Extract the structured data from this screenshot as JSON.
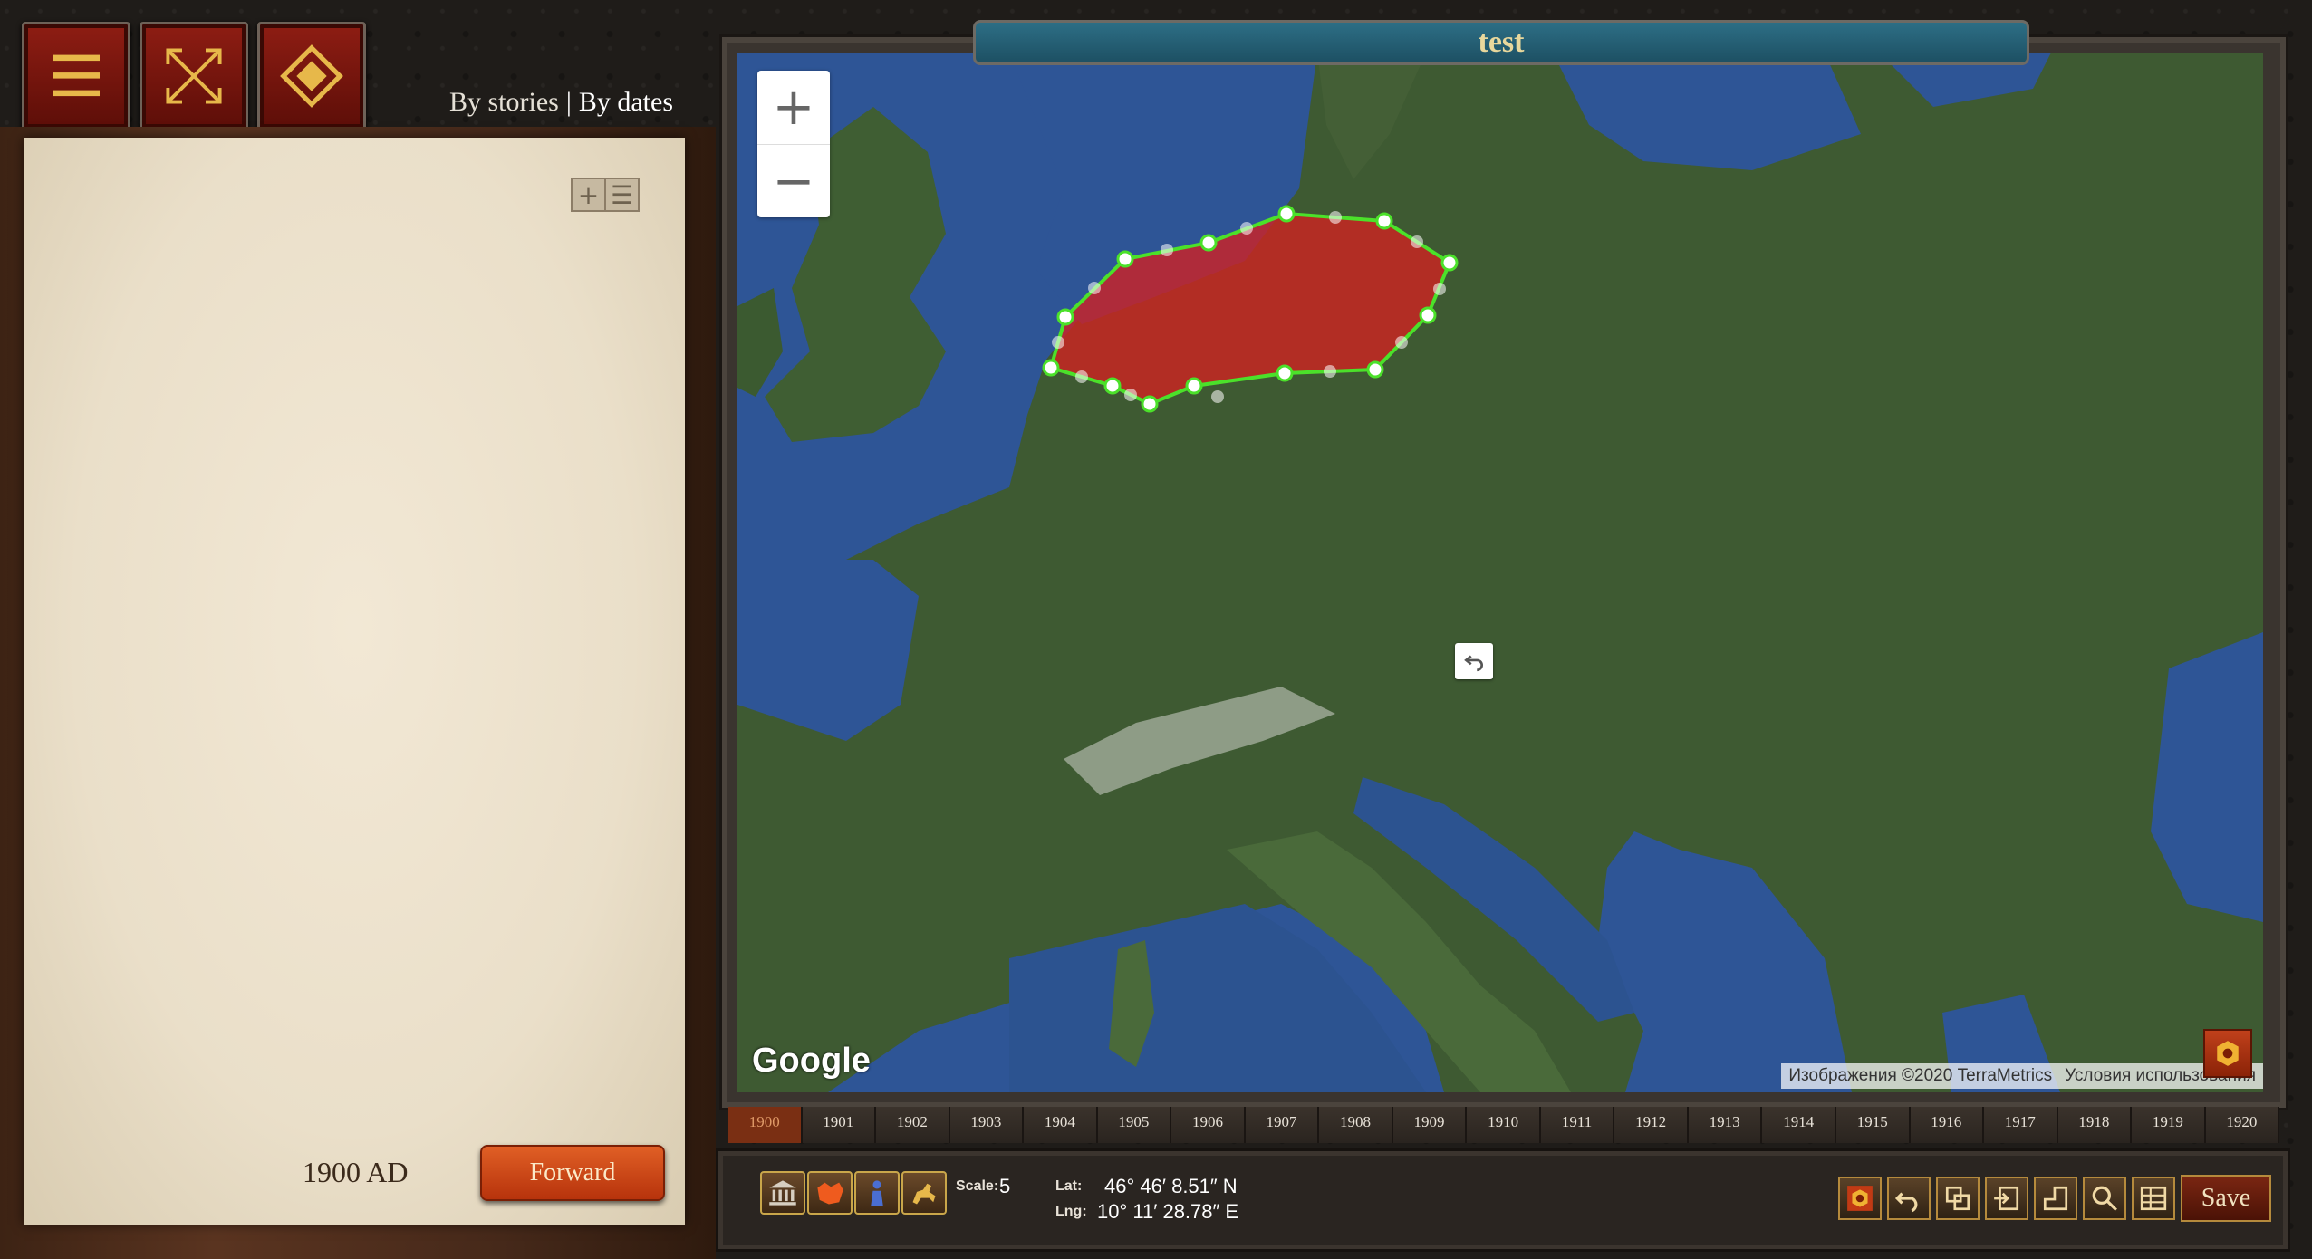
{
  "header": {
    "menu_icon": "hamburger-icon",
    "expand_icon": "expand-arrows-icon",
    "compass_icon": "compass-diamond-icon",
    "view_by_stories": "By stories",
    "separator": "|",
    "view_by_dates": "By dates"
  },
  "panel": {
    "add_icon": "+",
    "list_icon": "☰",
    "date_label": "1900 AD",
    "forward_label": "Forward"
  },
  "map": {
    "title": "test",
    "zoom_in": "+",
    "zoom_out": "−",
    "logo": "Google",
    "attribution": "Изображения ©2020 TerraMetrics",
    "terms": "Условия использования",
    "polygon_color": "#d32020",
    "polygon_stroke": "#4be12a",
    "undo_icon": "undo-icon"
  },
  "timeline": {
    "years": [
      "1900",
      "1901",
      "1902",
      "1903",
      "1904",
      "1905",
      "1906",
      "1907",
      "1908",
      "1909",
      "1910",
      "1911",
      "1912",
      "1913",
      "1914",
      "1915",
      "1916",
      "1917",
      "1918",
      "1919",
      "1920"
    ],
    "active": "1900"
  },
  "toolbar": {
    "scale_label": "Scale:",
    "scale_value": "5",
    "lat_label": "Lat:",
    "lat_value": "46° 46′ 8.51″ N",
    "lng_label": "Lng:",
    "lng_value": "10° 11′ 28.78″ E",
    "save_label": "Save"
  }
}
